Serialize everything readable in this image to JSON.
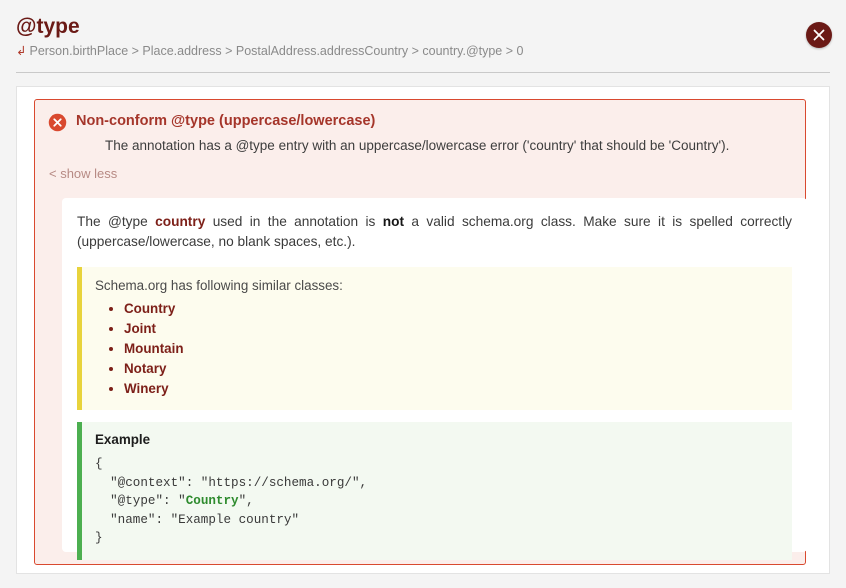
{
  "header": {
    "title": "@type",
    "breadcrumb_icon": "subdirectory-arrow-right-icon",
    "breadcrumb": "Person.birthPlace > Place.address > PostalAddress.addressCountry > country.@type > 0",
    "close_icon": "close-icon"
  },
  "alert": {
    "icon": "error-circle-icon",
    "title": "Non-conform @type (uppercase/lowercase)",
    "description": "The annotation has a @type entry with an uppercase/lowercase error ('country' that should be 'Country').",
    "toggle_label": "< show less"
  },
  "detail": {
    "explanation": {
      "part1": "The @type ",
      "term": "country",
      "part2": " used in the annotation is ",
      "negation": "not",
      "part3": " a valid schema.org class. Make sure it is spelled correctly (uppercase/lowercase, no blank spaces, etc.)."
    },
    "similar": {
      "heading": "Schema.org has following similar classes:",
      "classes": [
        "Country",
        "Joint",
        "Mountain",
        "Notary",
        "Winery"
      ]
    },
    "example": {
      "heading": "Example",
      "line1": "{",
      "line2_pre": "  \"@context\": \"https://schema.org/\",",
      "line3_pre": "  \"@type\": \"",
      "line3_hl": "Country",
      "line3_post": "\",",
      "line4": "  \"name\": \"Example country\"",
      "line5": "}"
    }
  },
  "colors": {
    "page_bg": "#f4f4f4",
    "title": "#6b1a16",
    "alert_border": "#d9492f",
    "alert_bg": "#fbeeeb",
    "alert_title": "#a5352a",
    "similar_accent": "#e8d33c",
    "similar_bg": "#fdfcee",
    "example_accent": "#4caf50",
    "example_bg": "#f3f9f1",
    "close_bg": "#6b1a16"
  }
}
